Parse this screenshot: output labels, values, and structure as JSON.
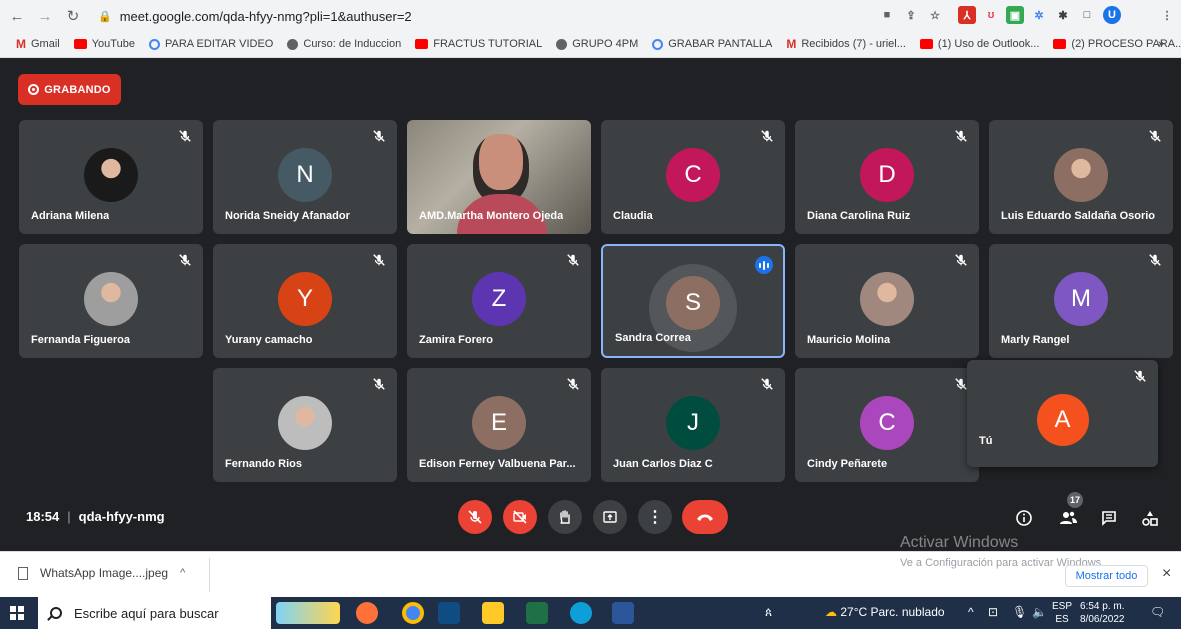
{
  "browser": {
    "url": "meet.google.com/qda-hfyy-nmg?pli=1&authuser=2",
    "profile_initial": "U",
    "bookmarks": [
      {
        "label": "Gmail",
        "icon": "gmail-icon"
      },
      {
        "label": "YouTube",
        "icon": "youtube-icon"
      },
      {
        "label": "PARA EDITAR VIDEO",
        "icon": "circle-icon"
      },
      {
        "label": "Curso: de Induccion",
        "icon": "globe-icon"
      },
      {
        "label": "FRACTUS TUTORIAL",
        "icon": "youtube-icon"
      },
      {
        "label": "GRUPO 4PM",
        "icon": "globe-icon"
      },
      {
        "label": "GRABAR PANTALLA",
        "icon": "screen-recorder-icon"
      },
      {
        "label": "Recibidos (7) - uriel...",
        "icon": "gmail-icon"
      },
      {
        "label": "(1) Uso de Outlook...",
        "icon": "youtube-icon"
      },
      {
        "label": "(2) PROCESO PARA...",
        "icon": "youtube-icon"
      }
    ],
    "more_bookmarks": "»"
  },
  "meeting": {
    "recording_label": "GRABANDO",
    "participants": [
      {
        "name": "Adriana Milena",
        "initial": "",
        "color": "#1a1a1a",
        "photo": true,
        "muted": true
      },
      {
        "name": "Norida Sneidy Afanador",
        "initial": "N",
        "color": "#455a64",
        "photo": false,
        "muted": true
      },
      {
        "name": "AMD.Martha Montero Ojeda",
        "initial": "",
        "color": "#6d6a60",
        "photo": true,
        "video": true,
        "muted": false
      },
      {
        "name": "Claudia",
        "initial": "C",
        "color": "#c2185b",
        "photo": false,
        "muted": true
      },
      {
        "name": "Diana Carolina Ruiz",
        "initial": "D",
        "color": "#c2185b",
        "photo": false,
        "muted": true
      },
      {
        "name": "Luis Eduardo Saldaña Osorio",
        "initial": "",
        "color": "#8d6e63",
        "photo": true,
        "muted": true
      },
      {
        "name": "Fernanda Figueroa",
        "initial": "",
        "color": "#9e9e9e",
        "photo": true,
        "muted": true
      },
      {
        "name": "Yurany camacho",
        "initial": "Y",
        "color": "#d84315",
        "photo": false,
        "muted": true
      },
      {
        "name": "Zamira Forero",
        "initial": "Z",
        "color": "#5e35b1",
        "photo": false,
        "muted": true
      },
      {
        "name": "Sandra Correa",
        "initial": "S",
        "color": "#8d6e63",
        "photo": false,
        "muted": false,
        "speaking": true
      },
      {
        "name": "Mauricio Molina",
        "initial": "",
        "color": "#a1887f",
        "photo": true,
        "muted": true
      },
      {
        "name": "Marly Rangel",
        "initial": "M",
        "color": "#7e57c2",
        "photo": false,
        "muted": true
      },
      {
        "name": "Fernando Rios",
        "initial": "",
        "color": "#bdbdbd",
        "photo": true,
        "muted": true
      },
      {
        "name": "Edison Ferney Valbuena Par...",
        "initial": "E",
        "color": "#8d6e63",
        "photo": false,
        "muted": true
      },
      {
        "name": "Juan Carlos Diaz C",
        "initial": "J",
        "color": "#004d40",
        "photo": false,
        "muted": true
      },
      {
        "name": "Cindy Peñarete",
        "initial": "C",
        "color": "#ab47bc",
        "photo": false,
        "muted": true
      }
    ],
    "self": {
      "name": "Tú",
      "initial": "A",
      "color": "#f4511e"
    },
    "time": "18:54",
    "meeting_code": "qda-hfyy-nmg",
    "participant_count": "17",
    "watermark_title": "Activar Windows",
    "watermark_sub": "Ve a Configuración para activar Windows."
  },
  "downloads": {
    "file_name": "WhatsApp Image....jpeg",
    "show_all": "Mostrar todo",
    "close": "×"
  },
  "taskbar": {
    "search_placeholder": "Escribe aquí para buscar",
    "weather": "27°C  Parc. nublado",
    "lang_top": "ESP",
    "lang_bottom": "ES",
    "time": "6:54 p. m.",
    "date": "8/06/2022"
  },
  "colors": {
    "meet_bg": "#202124",
    "tile_bg": "#3c4043",
    "danger": "#ea4335",
    "accent": "#1a73e8"
  }
}
